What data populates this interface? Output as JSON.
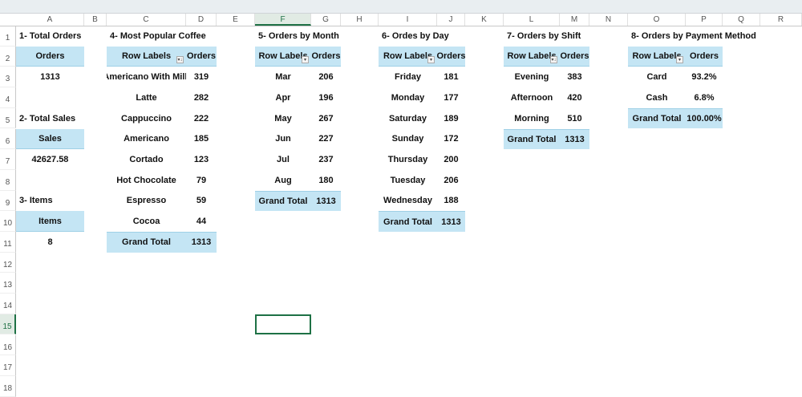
{
  "columns": [
    "A",
    "B",
    "C",
    "D",
    "E",
    "F",
    "G",
    "H",
    "I",
    "J",
    "K",
    "L",
    "M",
    "N",
    "O",
    "P",
    "Q",
    "R"
  ],
  "rows": [
    "1",
    "2",
    "3",
    "4",
    "5",
    "6",
    "7",
    "8",
    "9",
    "10",
    "11",
    "12",
    "13",
    "14",
    "15",
    "16",
    "17",
    "18"
  ],
  "selected_cell": "F15",
  "kpis": [
    {
      "title": "1- Total  Orders",
      "header": "Orders",
      "value": "1313"
    },
    {
      "title": "2- Total Sales",
      "header": "Sales",
      "value": "42627.58"
    },
    {
      "title": "3- Items",
      "header": "Items",
      "value": "8"
    }
  ],
  "pivots": [
    {
      "title": "4- Most Popular Coffee",
      "row_header": "Row Labels",
      "value_header": "Orders",
      "filter_icon": "sort-filter-icon",
      "rows": [
        [
          "Americano With Milk",
          "319"
        ],
        [
          "Latte",
          "282"
        ],
        [
          "Cappuccino",
          "222"
        ],
        [
          "Americano",
          "185"
        ],
        [
          "Cortado",
          "123"
        ],
        [
          "Hot Chocolate",
          "79"
        ],
        [
          "Espresso",
          "59"
        ],
        [
          "Cocoa",
          "44"
        ]
      ],
      "total": [
        "Grand Total",
        "1313"
      ]
    },
    {
      "title": "5- Orders by Month",
      "row_header": "Row Labels",
      "value_header": "Orders",
      "filter_icon": "filter-dropdown-icon",
      "rows": [
        [
          "Mar",
          "206"
        ],
        [
          "Apr",
          "196"
        ],
        [
          "May",
          "267"
        ],
        [
          "Jun",
          "227"
        ],
        [
          "Jul",
          "237"
        ],
        [
          "Aug",
          "180"
        ]
      ],
      "total": [
        "Grand Total",
        "1313"
      ]
    },
    {
      "title": "6- Ordes by Day",
      "row_header": "Row Labels",
      "value_header": "Orders",
      "filter_icon": "filter-dropdown-icon",
      "rows": [
        [
          "Friday",
          "181"
        ],
        [
          "Monday",
          "177"
        ],
        [
          "Saturday",
          "189"
        ],
        [
          "Sunday",
          "172"
        ],
        [
          "Thursday",
          "200"
        ],
        [
          "Tuesday",
          "206"
        ],
        [
          "Wednesday",
          "188"
        ]
      ],
      "total": [
        "Grand Total",
        "1313"
      ]
    },
    {
      "title": "7- Orders by Shift",
      "row_header": "Row Labels",
      "value_header": "Orders",
      "filter_icon": "sort-filter-icon",
      "rows": [
        [
          "Evening",
          "383"
        ],
        [
          "Afternoon",
          "420"
        ],
        [
          "Morning",
          "510"
        ]
      ],
      "total": [
        "Grand Total",
        "1313"
      ]
    },
    {
      "title": "8- Orders by Payment Method",
      "row_header": "Row Labels",
      "value_header": "Orders",
      "filter_icon": "filter-dropdown-icon",
      "rows": [
        [
          "Card",
          "93.2%"
        ],
        [
          "Cash",
          "6.8%"
        ]
      ],
      "total": [
        "Grand Total",
        "100.00%"
      ]
    }
  ]
}
